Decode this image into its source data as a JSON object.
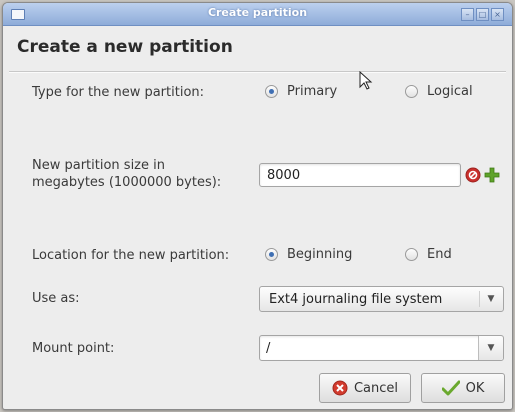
{
  "window": {
    "title": "Create partition"
  },
  "dialog": {
    "heading": "Create a new partition"
  },
  "type": {
    "label": "Type for the new partition:",
    "options": [
      "Primary",
      "Logical"
    ],
    "selected": "Primary"
  },
  "size": {
    "label_line1": "New partition size in",
    "label_line2": "megabytes (1000000 bytes):",
    "value": "8000"
  },
  "location": {
    "label": "Location for the new partition:",
    "options": [
      "Beginning",
      "End"
    ],
    "selected": "Beginning"
  },
  "use_as": {
    "label": "Use as:",
    "value": "Ext4 journaling file system"
  },
  "mount_point": {
    "label": "Mount point:",
    "value": "/"
  },
  "buttons": {
    "cancel": "Cancel",
    "ok": "OK"
  },
  "icons": {
    "window_menu": "window-menu-icon",
    "minimize": "minimize-icon",
    "maximize": "maximize-icon",
    "close": "close-icon",
    "clear": "clear-icon",
    "add": "add-icon",
    "combo_arrow": "chevron-down-icon",
    "cancel": "cancel-icon",
    "ok": "checkmark-icon",
    "cursor": "mouse-pointer-icon"
  },
  "colors": {
    "titlebar": "#8eacd9",
    "radio_selected": "#3f6fb3",
    "clear_icon": "#c9302c",
    "add_icon": "#5fa32a"
  }
}
